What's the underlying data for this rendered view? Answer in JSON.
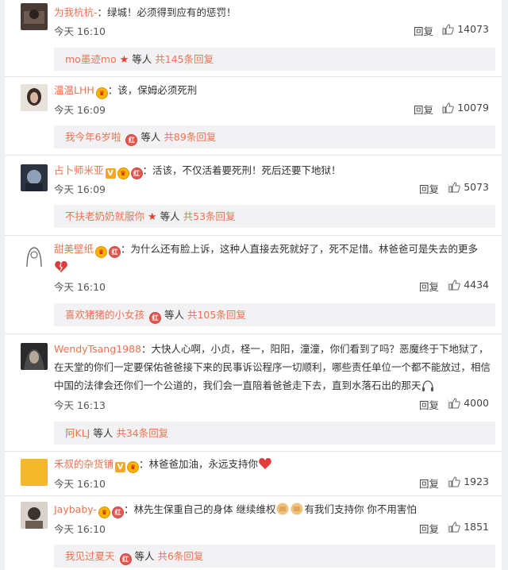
{
  "comments": [
    {
      "user": "为我杭杭-",
      "badges": [],
      "text": "：绿城！必须得到应有的惩罚！",
      "time": "今天 16:10",
      "reply": "回复",
      "likes": "14073",
      "sub": {
        "user": "mo墨迹mo",
        "mark": "★",
        "mid": "等人",
        "total": "共145条回复"
      }
    },
    {
      "user": "温温LHH",
      "badges": [
        "vip"
      ],
      "text": "：该，保姆必须死刑",
      "time": "今天 16:09",
      "reply": "回复",
      "likes": "10079",
      "sub": {
        "user": "我今年6岁啦",
        "mark": "红",
        "mid": "等人",
        "total": "共89条回复"
      }
    },
    {
      "user": "占卜师米亚",
      "badges": [
        "v",
        "vip",
        "red"
      ],
      "text": "：活该，不仅活着要死刑！死后还要下地狱！",
      "time": "今天 16:09",
      "reply": "回复",
      "likes": "5073",
      "sub": {
        "user": "不扶老奶奶就服你",
        "mark": "★",
        "mid": "等人",
        "total": "共53条回复"
      }
    },
    {
      "user": "甜美壁纸",
      "badges": [
        "vip",
        "red"
      ],
      "text": "：为什么还有脸上诉，这种人直接去死就好了，死不足惜。林爸爸可是失去的更多",
      "time": "今天 16:10",
      "reply": "回复",
      "likes": "4434",
      "sub": {
        "user": "喜欢猪猪的小女孩",
        "mark": "红",
        "mid": "等人",
        "total": "共105条回复"
      }
    },
    {
      "user": "WendyTsang1988",
      "badges": [],
      "text": "：大快人心啊，小贞，柽一，阳阳，潼潼，你们看到了吗？恶魔终于下地狱了，在天堂的你们一定要保佑爸爸接下来的民事诉讼程序一切顺利，哪些责任单位一个都不能放过，相信中国的法律会还你们一个公道的，我们会一直陪着爸爸走下去，直到水落石出的那天",
      "time": "今天 16:13",
      "reply": "回复",
      "likes": "4000",
      "sub": {
        "user": "阿KLJ",
        "mark": "",
        "mid": "等人",
        "total": "共34条回复"
      }
    },
    {
      "user": "禾叔的杂货铺",
      "badges": [
        "v",
        "vip"
      ],
      "text": "：林爸爸加油，永远支持你",
      "time": "今天 16:10",
      "reply": "回复",
      "likes": "1923"
    },
    {
      "user": "Jaybaby-",
      "badges": [
        "vip",
        "red"
      ],
      "text": "：林先生保重自己的身体 继续维权",
      "text2": "有我们支持你 你不用害怕",
      "time": "今天 16:10",
      "reply": "回复",
      "likes": "1851",
      "sub": {
        "user": "我见过夏天",
        "mark": "红",
        "mid": "等人",
        "total": "共6条回复"
      }
    }
  ],
  "colors": {
    "accent": "#eb7350",
    "subbox": "#f2f2f5"
  }
}
